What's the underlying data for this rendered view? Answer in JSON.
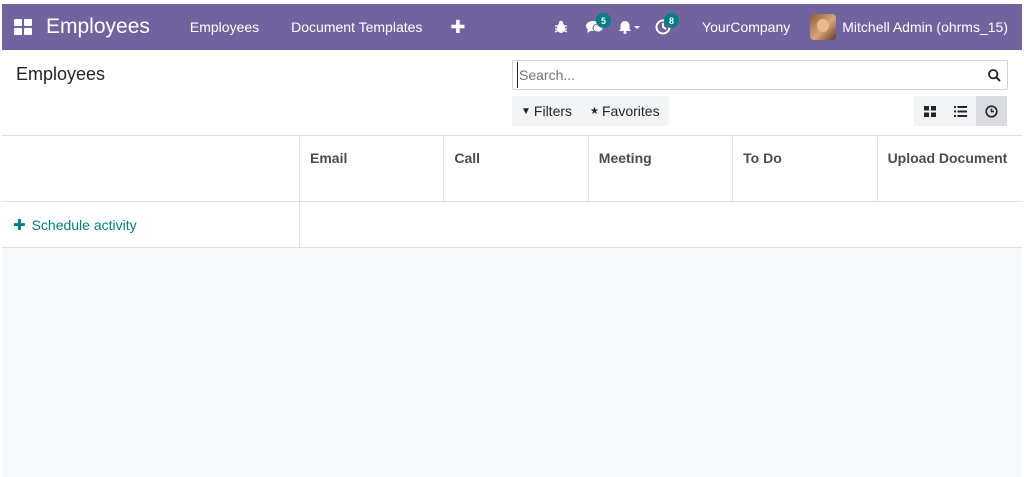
{
  "navbar": {
    "app_title": "Employees",
    "menu": [
      "Employees",
      "Document Templates"
    ],
    "add_label": "✚",
    "chat_badge": "5",
    "activity_badge": "8",
    "company": "YourCompany",
    "user_name": "Mitchell Admin (ohrms_15)",
    "color": "#71639e"
  },
  "control_panel": {
    "page_title": "Employees",
    "search_placeholder": "Search...",
    "filters_label": "Filters",
    "favorites_label": "Favorites"
  },
  "activity": {
    "columns": [
      "Email",
      "Call",
      "Meeting",
      "To Do",
      "Upload Document"
    ],
    "schedule_label": "Schedule activity",
    "accent": "#017e84"
  }
}
